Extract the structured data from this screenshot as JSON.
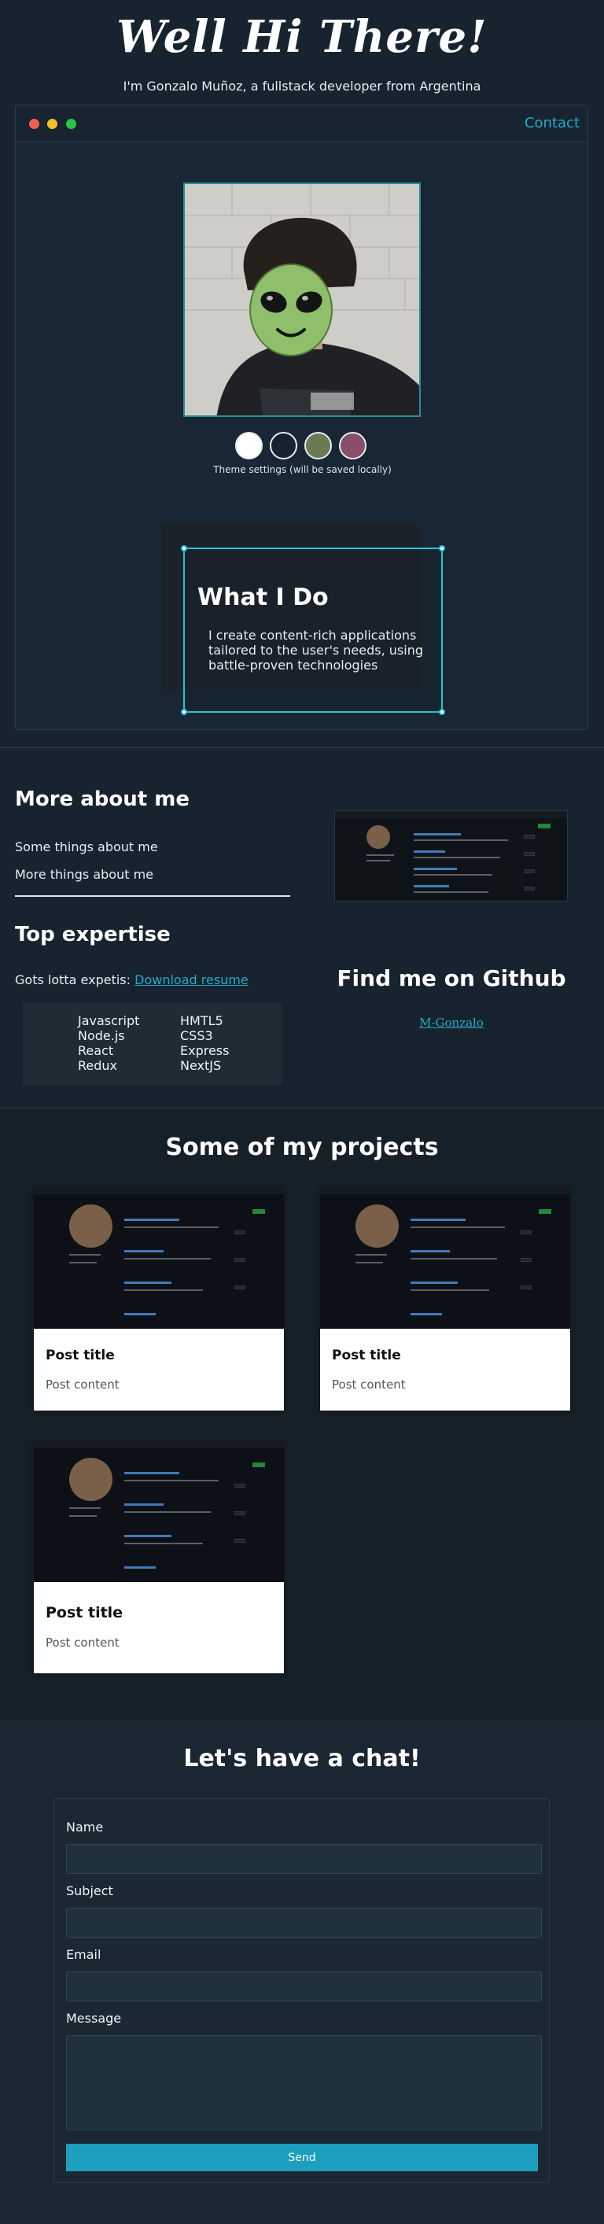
{
  "hero": {
    "title": "Well Hi There!",
    "subtitle": "I'm Gonzalo Muñoz, a fullstack developer from Argentina"
  },
  "window": {
    "contact_label": "Contact",
    "theme_note": "Theme settings (will be saved locally)",
    "theme_swatches": [
      "#ffffff",
      "#17232e",
      "#6b7a52",
      "#8a4d6a"
    ],
    "what_title": "What I Do",
    "what_text": "I create content-rich applications tailored to the user's needs, using battle-proven technologies"
  },
  "about": {
    "title": "More about me",
    "line1": "Some things about me",
    "line2": "More things about me",
    "expertise_title": "Top expertise",
    "expertise_text": "Gots lotta expetis:",
    "resume_link": "Download resume",
    "skills_left": [
      "Javascript",
      "Node.js",
      "React",
      "Redux"
    ],
    "skills_right": [
      "HMTL5",
      "CSS3",
      "Express",
      "NextJS"
    ],
    "github_title": "Find me on Github",
    "github_name": "M-Gonzalo"
  },
  "projects": {
    "title": "Some of my projects",
    "cards": [
      {
        "title": "Post title",
        "content": "Post content"
      },
      {
        "title": "Post title",
        "content": "Post content"
      },
      {
        "title": "Post title",
        "content": "Post content"
      }
    ]
  },
  "contact": {
    "title": "Let's have a chat!",
    "name_label": "Name",
    "subject_label": "Subject",
    "email_label": "Email",
    "message_label": "Message",
    "send_label": "Send"
  },
  "colors": {
    "background": "#17232e",
    "accent": "#27a9c9",
    "send_button": "#1d9fbf"
  }
}
